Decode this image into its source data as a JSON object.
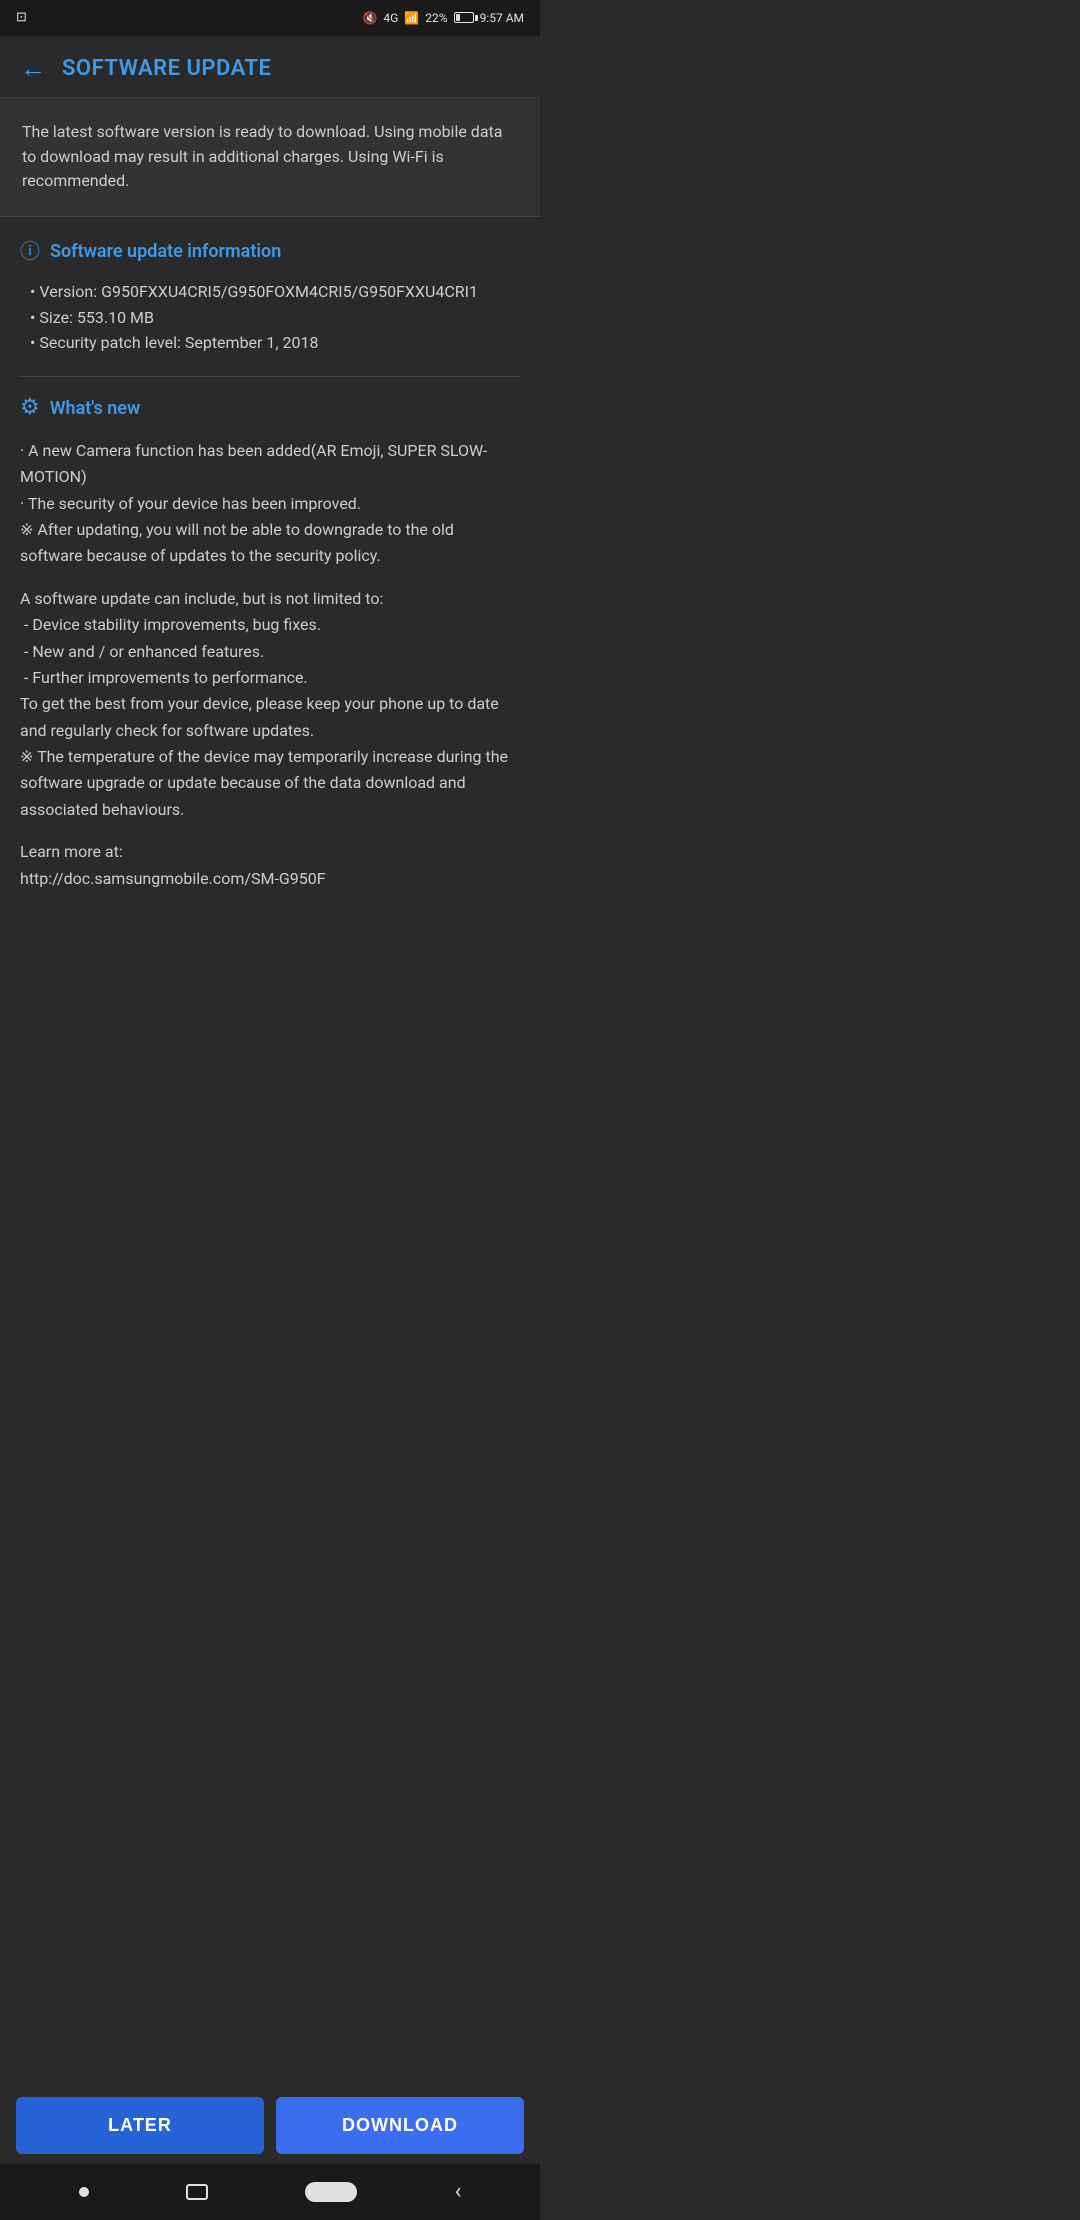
{
  "statusBar": {
    "time": "9:57 AM",
    "battery": "22%",
    "network": "4G"
  },
  "header": {
    "title": "SOFTWARE UPDATE",
    "backLabel": "←"
  },
  "notice": {
    "text": "The latest software version is ready to download. Using mobile data to download may result in additional charges. Using Wi-Fi is recommended."
  },
  "updateInfo": {
    "sectionTitle": "Software update information",
    "items": [
      "• Version: G950FXXU4CRI5/G950FOXM4CRI5/G950FXXU4CRI1",
      "• Size: 553.10 MB",
      "• Security patch level: September 1, 2018"
    ]
  },
  "whatsNew": {
    "title": "What's new",
    "content": "· A new Camera function has been added(AR Emoji, SUPER SLOW-MOTION)\n· The security of your device has been improved.\n※ After updating, you will not be able to downgrade to the old software because of updates to the security policy."
  },
  "moreInfo": {
    "content": "A software update can include, but is not limited to:\n - Device stability improvements, bug fixes.\n - New and / or enhanced features.\n - Further improvements to performance.\nTo get the best from your device, please keep your phone up to date and regularly check for software updates.\n※ The temperature of the device may temporarily increase during the software upgrade or update because of the data download and associated behaviours."
  },
  "learnMore": {
    "label": "Learn more at:",
    "url": "http://doc.samsungmobile.com/SM-G950F"
  },
  "buttons": {
    "later": "LATER",
    "download": "DOWNLOAD"
  },
  "colors": {
    "accent": "#3d9ae8",
    "background": "#2a2a2a",
    "buttonLater": "#2563d6",
    "buttonDownload": "#3b6def"
  }
}
